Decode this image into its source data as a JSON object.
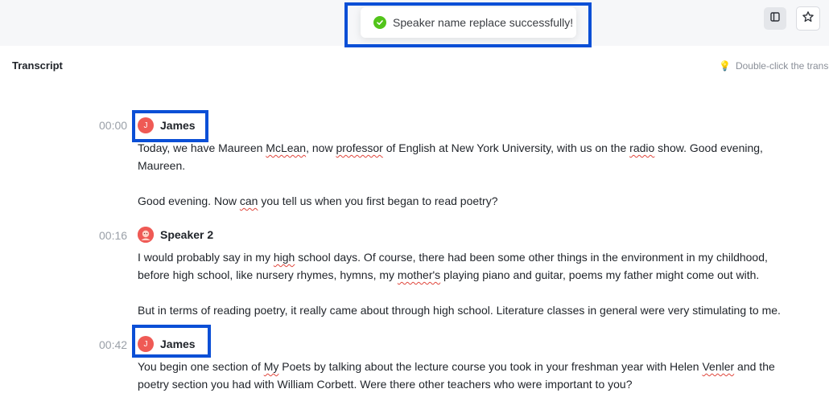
{
  "toast": {
    "message": "Speaker name replace successfully!"
  },
  "header": {
    "title": "Transcript",
    "hint": "Double-click the transc"
  },
  "toolbar": {
    "sidebar_icon": "sidebar-toggle-icon",
    "star_icon": "star-icon"
  },
  "segments": [
    {
      "time": "00:00",
      "speaker": "James",
      "avatar": "J",
      "paragraphs": [
        {
          "parts": [
            "Today, we have Maureen ",
            "McLean",
            ", now ",
            "professor",
            " of English at New York University, with us on the ",
            "radio",
            " show. Good evening,"
          ],
          "line2": "Maureen."
        },
        {
          "parts": [
            "Good evening. Now ",
            "can",
            " you tell us when you first began to read poetry?"
          ]
        }
      ]
    },
    {
      "time": "00:16",
      "speaker": "Speaker 2",
      "avatar": "",
      "paragraphs": [
        {
          "parts": [
            "I would probably say in my ",
            "high",
            " school days. Of course, there had been some other things in the environment in my childhood,"
          ],
          "line2_parts": [
            "before high school, like nursery rhymes, hymns, my ",
            "mother's",
            " playing piano and guitar, poems my father might come out with."
          ]
        },
        {
          "text": "But in terms of reading poetry, it really came about through high school. Literature classes in general were very stimulating to me."
        }
      ]
    },
    {
      "time": "00:42",
      "speaker": "James",
      "avatar": "J",
      "paragraphs": [
        {
          "parts": [
            "You begin one section of ",
            "My",
            " Poets by talking about the lecture course you took in your freshman year with Helen ",
            "Venler",
            " and the"
          ],
          "line2": "poetry section you had with William Corbett. Were there other teachers who were important to you?"
        }
      ]
    }
  ],
  "colors": {
    "accent_highlight": "#0b4fd6",
    "success": "#52c41a",
    "avatar": "#ef5a55"
  }
}
